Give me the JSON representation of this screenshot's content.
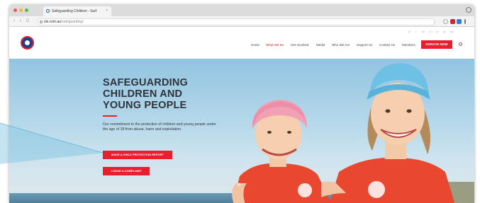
{
  "browser": {
    "tab_title": "Safeguarding Children - Surf",
    "tab_close": "×",
    "url_domain": "sls.com.au",
    "url_path": "/safeguarding/",
    "back": "‹",
    "forward": "›",
    "reload": "C"
  },
  "site": {
    "menu": [
      {
        "label": "Home",
        "active": false
      },
      {
        "label": "What We Do",
        "active": true
      },
      {
        "label": "Get Involved",
        "active": false
      },
      {
        "label": "Media",
        "active": false
      },
      {
        "label": "Who We Are",
        "active": false
      },
      {
        "label": "Support Us",
        "active": false
      },
      {
        "label": "Contact Us",
        "active": false
      },
      {
        "label": "Members",
        "active": false
      }
    ],
    "donate_label": "DONATE NOW",
    "social_icons": [
      "in",
      "f",
      "tw",
      "G+",
      "yt",
      "ig",
      "ig2"
    ]
  },
  "hero": {
    "title_line1": "SAFEGUARDING",
    "title_line2": "CHILDREN AND",
    "title_line3": "YOUNG PEOPLE",
    "body": "Our commitment to the protection of children and young people under the age of 18 from abuse, harm and exploitation.",
    "btn_report": "MAKE A CHILD PROTECTION REPORT",
    "btn_complaint": "LODGE A COMPLAINT",
    "scroll_glyph": "»"
  },
  "colors": {
    "brand_red": "#e8202e",
    "navy": "#1e3f8a",
    "title_text": "#2f3439"
  }
}
